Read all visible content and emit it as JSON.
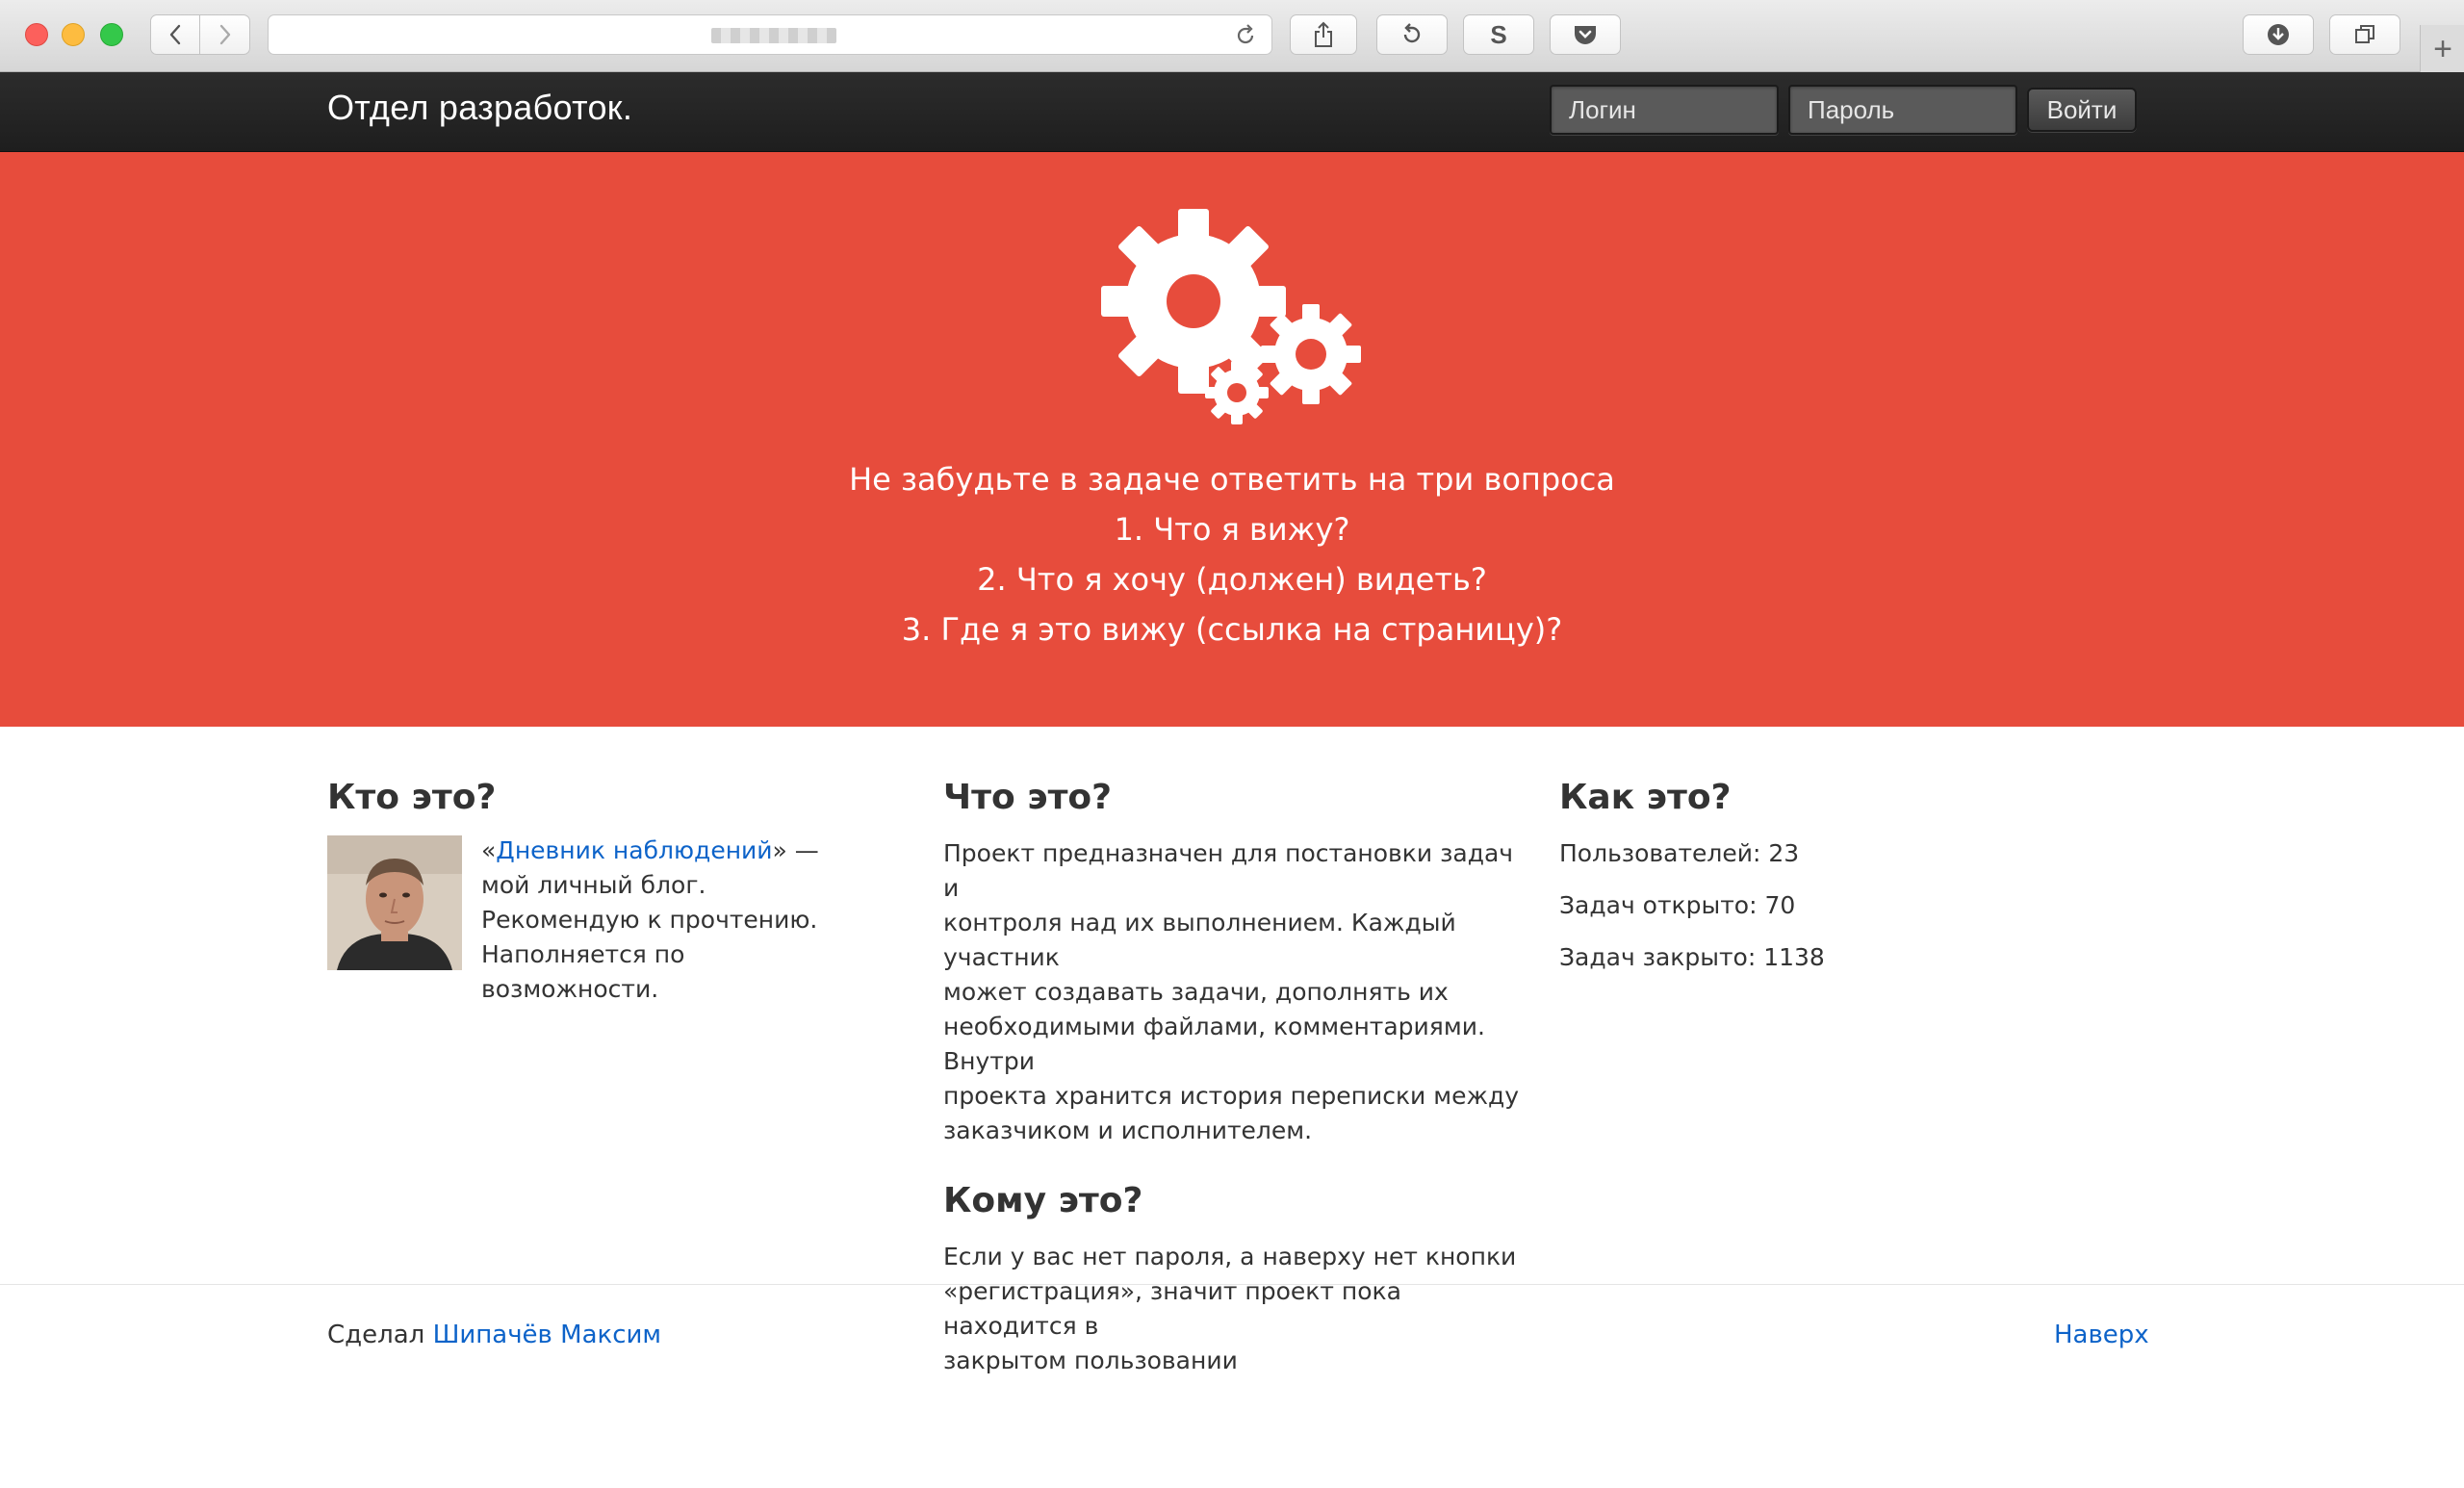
{
  "browser": {
    "toolbar_icons": [
      "back-icon",
      "forward-icon",
      "reload-icon",
      "share-icon",
      "history-icon",
      "s-extension-icon",
      "pocket-icon",
      "download-icon",
      "tabs-icon",
      "new-tab-icon"
    ],
    "s_extension_label": "S",
    "new_tab_label": "+"
  },
  "navbar": {
    "brand": "Отдел разработок.",
    "login_placeholder": "Логин",
    "password_placeholder": "Пароль",
    "submit_label": "Войти"
  },
  "hero": {
    "icon": "gears-icon",
    "line1": "Не забудьте в задаче ответить на три вопроса",
    "line2": "1. Что я вижу?",
    "line3": "2. Что я хочу (должен) видеть?",
    "line4": "3. Где я это вижу (ссылка на страницу)?",
    "background_color": "#e74c3c"
  },
  "who": {
    "heading": "Кто это?",
    "quote_open": "«",
    "blog_link": "Дневник наблюдений",
    "quote_close": "» —",
    "line2": "мой личный блог.",
    "line3": "Рекомендую к прочтению.",
    "line4": "Наполняется по возможности."
  },
  "what": {
    "heading": "Что это?",
    "lines": [
      "Проект предназначен для постановки задач и",
      "контроля над их выполнением. Каждый участник",
      "может создавать задачи, дополнять их",
      "необходимыми файлами, комментариями. Внутри",
      "проекта хранится история переписки между",
      "заказчиком и исполнителем."
    ]
  },
  "whom": {
    "heading": "Кому это?",
    "lines": [
      "Если у вас нет пароля, а наверху нет кнопки",
      "«регистрация», значит проект пока находится в",
      "закрытом пользовании"
    ]
  },
  "how": {
    "heading": "Как это?",
    "users": "Пользователей: 23",
    "open": "Задач открыто: 70",
    "closed": "Задач закрыто: 1138"
  },
  "footer": {
    "made_by": "Сделал",
    "author": "Шипачёв Максим",
    "top_link": "Наверх"
  },
  "colors": {
    "link": "#0d63c9",
    "navbar": "#222222"
  }
}
